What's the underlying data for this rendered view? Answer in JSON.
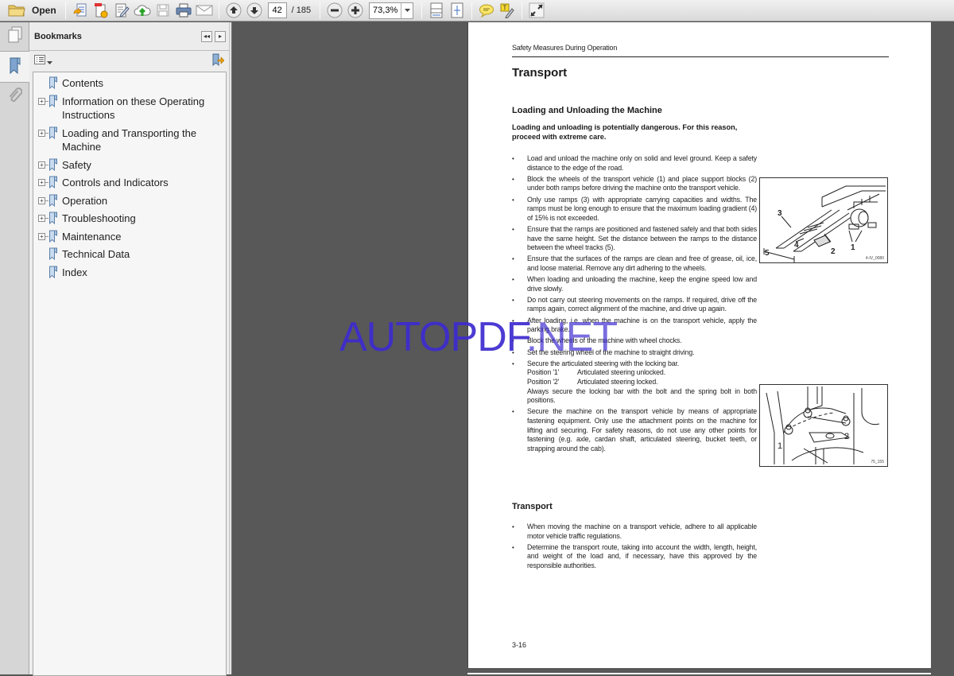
{
  "toolbar": {
    "open_label": "Open",
    "current_page": "42",
    "page_total": "/ 185",
    "zoom_value": "73,3%",
    "icons": [
      "folder-open",
      "create-pdf",
      "create-pdf-from-file",
      "edit",
      "upload-cloud",
      "save",
      "print",
      "email",
      "page-up",
      "page-down",
      "zoom-out",
      "zoom-in",
      "zoom-dropdown",
      "fit-page-width",
      "fit-page",
      "comment",
      "highlight-text",
      "fullscreen"
    ]
  },
  "sidebar": {
    "panel_title": "Bookmarks",
    "rail_icons": [
      "page-thumbnails",
      "bookmarks",
      "attachments"
    ],
    "bookmarks": [
      {
        "label": "Contents",
        "expandable": false
      },
      {
        "label": "Information on these Operating Instructions",
        "expandable": true
      },
      {
        "label": "Loading and Transporting the Machine",
        "expandable": true
      },
      {
        "label": "Safety",
        "expandable": true
      },
      {
        "label": "Controls and Indicators",
        "expandable": true
      },
      {
        "label": "Operation",
        "expandable": true
      },
      {
        "label": "Troubleshooting",
        "expandable": true
      },
      {
        "label": "Maintenance",
        "expandable": true
      },
      {
        "label": "Technical Data",
        "expandable": false
      },
      {
        "label": "Index",
        "expandable": false
      }
    ]
  },
  "document": {
    "running_head": "Safety Measures During Operation",
    "title": "Transport",
    "section1": {
      "heading": "Loading and Unloading the Machine",
      "warning": "Loading and unloading is potentially dangerous. For this reason, proceed with extreme care.",
      "bullets": [
        "Load and unload the machine only on solid and level ground. Keep a safety distance to the edge of the road.",
        "Block the wheels of the transport vehicle (1) and place support blocks (2) under both ramps before driving the machine onto the transport vehicle.",
        "Only use ramps (3) with appropriate carrying capacities and widths. The ramps must be long enough to ensure that the maximum loading gradient (4) of 15% is not exceeded.",
        "Ensure that the ramps are positioned and fastened safely and that both sides have the same height. Set the distance between the ramps to the distance between the wheel tracks (5).",
        "Ensure that the surfaces of the ramps are clean and free of grease, oil, ice, and loose material. Remove any dirt adhering to the wheels.",
        "When loading and unloading the machine, keep the engine speed low and drive slowly.",
        "Do not carry out steering movements on the ramps. If required, drive off the ramps again, correct alignment of the machine, and drive up again.",
        "After loading, i.e. when the machine is on the transport vehicle, apply the parking brake.",
        "Block the wheels of the machine with wheel chocks.",
        "Set the steering wheel of the machine to straight driving."
      ],
      "locking_bar": {
        "intro": "Secure the articulated steering with the locking bar.",
        "positions": [
          {
            "key": "Position '1'",
            "value": "Articulated steering unlocked."
          },
          {
            "key": "Position '2'",
            "value": "Articulated steering locked."
          }
        ],
        "note": "Always secure the locking bar with the bolt and the spring bolt in both positions."
      },
      "last_bullet": "Secure the machine on the transport vehicle by means of appropriate fastening equipment. Only use the attachment points on the machine for lifting and securing. For safety reasons, do not use any other points for fastening (e.g. axle, cardan shaft, articulated steering, bucket teeth, or strapping around the cab)."
    },
    "section2": {
      "heading": "Transport",
      "bullets": [
        "When moving the machine on a transport vehicle, adhere to all applicable motor vehicle traffic regulations.",
        "Determine the transport route, taking into account the width, length, height, and weight of the load and, if necessary, have this approved by the responsible authorities."
      ]
    },
    "figure1": {
      "callouts": [
        "1",
        "2",
        "3",
        "4",
        "5"
      ],
      "id": "4-IV_0080"
    },
    "figure2": {
      "callouts": [
        "1",
        "2"
      ],
      "id": "75_155"
    },
    "page_number": "3-16"
  },
  "watermark": {
    "part1": "AUTOPDF",
    "part2": ".NET"
  },
  "colors": {
    "watermark": "#3d2bd0",
    "viewer_bg": "#585858",
    "toolbar_bg": "#e4e4e4"
  }
}
